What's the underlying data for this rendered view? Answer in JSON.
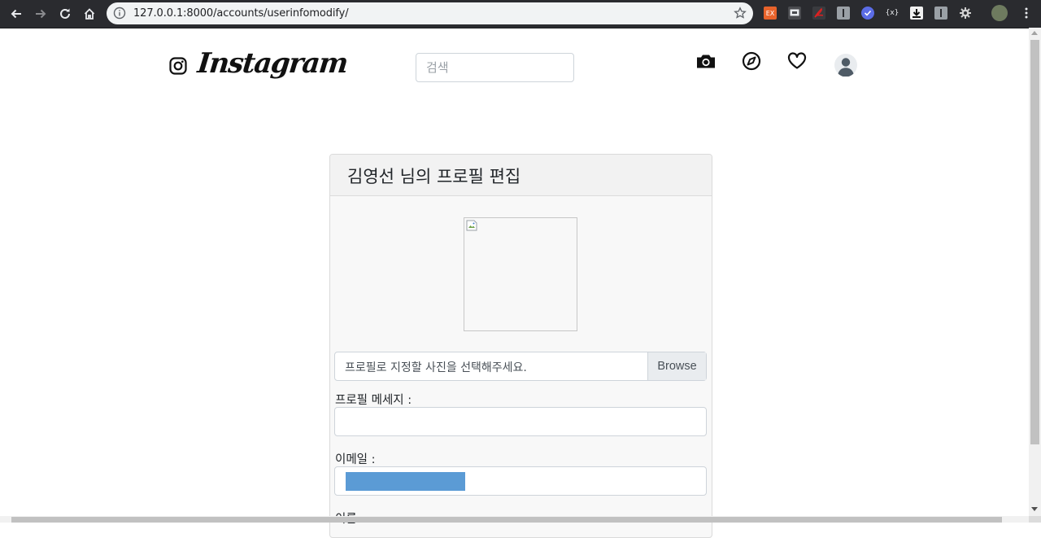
{
  "browser": {
    "url": "127.0.0.1:8000/accounts/userinfomodify/",
    "ext_badge": "EX"
  },
  "header": {
    "brand": "Instagram",
    "search_placeholder": "검색"
  },
  "card": {
    "title": "김영선 님의 프로필 편집",
    "file_label": "프로필로 지정할 사진을 선택해주세요.",
    "browse_label": "Browse",
    "message_label": "프로필 메세지 :",
    "message_value": "",
    "email_label": "이메일 :",
    "email_value": "",
    "name_label": "이름 :"
  },
  "colors": {
    "redaction": "#5b9bd5",
    "chrome_bg": "#2a2b2f"
  }
}
